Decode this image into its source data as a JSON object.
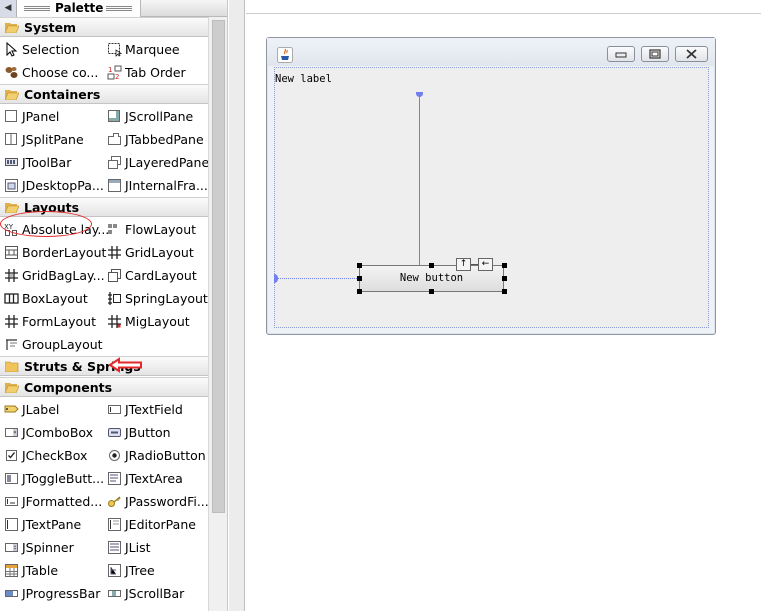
{
  "palette": {
    "title": "Palette",
    "categories": {
      "system": "System",
      "containers": "Containers",
      "layouts": "Layouts",
      "struts": "Struts & Springs",
      "components": "Components"
    },
    "system": [
      "Selection",
      "Marquee",
      "Choose co...",
      "Tab Order"
    ],
    "containers": [
      "JPanel",
      "JScrollPane",
      "JSplitPane",
      "JTabbedPane",
      "JToolBar",
      "JLayeredPane",
      "JDesktopPa...",
      "JInternalFra..."
    ],
    "layouts": [
      "Absolute lay...",
      "FlowLayout",
      "BorderLayout",
      "GridLayout",
      "GridBagLay...",
      "CardLayout",
      "BoxLayout",
      "SpringLayout",
      "FormLayout",
      "MigLayout",
      "GroupLayout"
    ],
    "components": [
      "JLabel",
      "JTextField",
      "JComboBox",
      "JButton",
      "JCheckBox",
      "JRadioButton",
      "JToggleButt...",
      "JTextArea",
      "JFormatted...",
      "JPasswordFi...",
      "JTextPane",
      "JEditorPane",
      "JSpinner",
      "JList",
      "JTable",
      "JTree",
      "JProgressBar",
      "JScrollBar"
    ]
  },
  "designer": {
    "label_text": "New label",
    "button_text": "New button",
    "anchor_up": "↑",
    "anchor_left": "←"
  },
  "colors": {
    "accent_guides": "#6f7ff0",
    "annotation_red": "#e22a2a"
  }
}
